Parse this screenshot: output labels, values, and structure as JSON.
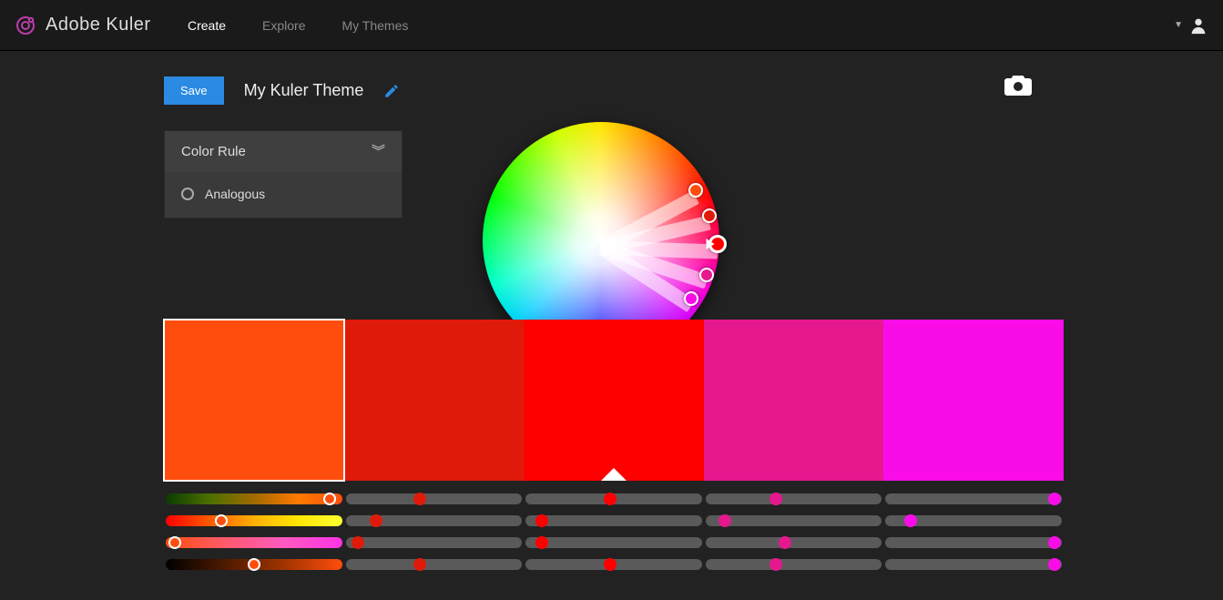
{
  "header": {
    "brand": "Adobe Kuler",
    "nav": {
      "create": "Create",
      "explore": "Explore",
      "mythemes": "My Themes"
    }
  },
  "toolbar": {
    "save_label": "Save",
    "theme_name": "My Kuler Theme"
  },
  "rule_panel": {
    "title": "Color Rule",
    "selected": "Analogous"
  },
  "colors": {
    "swatches": [
      "#FF4D0D",
      "#E01A0A",
      "#FF0000",
      "#E6188E",
      "#FA0CE8"
    ],
    "selected_index": 0,
    "base_index": 2
  },
  "wheel": {
    "handles": [
      {
        "angle": -28,
        "radius": 118,
        "color": "#FF4D0D",
        "base": false
      },
      {
        "angle": -13,
        "radius": 122,
        "color": "#E01A0A",
        "base": false
      },
      {
        "angle": 2,
        "radius": 128,
        "color": "#FF0000",
        "base": true
      },
      {
        "angle": 18,
        "radius": 122,
        "color": "#E6188E",
        "base": false
      },
      {
        "angle": 33,
        "radius": 118,
        "color": "#FA0CE8",
        "base": false
      }
    ]
  },
  "sliders": {
    "rows": [
      {
        "type": "hue-local",
        "cells": [
          {
            "gradient": "#0a3d00,#4d6f00,#a06a00,#ff7a00,#FF4D0D",
            "pos": 92,
            "thumb": "#FF4D0D",
            "selected": true
          },
          {
            "gradient": null,
            "pos": 42,
            "thumb": "#E01A0A"
          },
          {
            "gradient": null,
            "pos": 48,
            "thumb": "#FF0000"
          },
          {
            "gradient": null,
            "pos": 40,
            "thumb": "#E6188E"
          },
          {
            "gradient": null,
            "pos": 95,
            "thumb": "#FA0CE8"
          }
        ]
      },
      {
        "type": "hue-wide",
        "cells": [
          {
            "gradient": "#ff0000,#ff5a00,#ffb000,#ffe600,#ffff33",
            "pos": 32,
            "thumb": "#FF4D0D",
            "selected": true
          },
          {
            "gradient": null,
            "pos": 18,
            "thumb": "#E01A0A"
          },
          {
            "gradient": null,
            "pos": 10,
            "thumb": "#FF0000"
          },
          {
            "gradient": null,
            "pos": 12,
            "thumb": "#E6188E"
          },
          {
            "gradient": null,
            "pos": 15,
            "thumb": "#FA0CE8"
          }
        ]
      },
      {
        "type": "sat",
        "cells": [
          {
            "gradient": "#FF4D0D,#ff5a6a,#ff5abf,#ff33e6",
            "pos": 6,
            "thumb": "#FF4D0D",
            "selected": true
          },
          {
            "gradient": null,
            "pos": 8,
            "thumb": "#E01A0A"
          },
          {
            "gradient": null,
            "pos": 10,
            "thumb": "#FF0000"
          },
          {
            "gradient": null,
            "pos": 45,
            "thumb": "#E6188E"
          },
          {
            "gradient": null,
            "pos": 95,
            "thumb": "#FA0CE8"
          }
        ]
      },
      {
        "type": "bright",
        "cells": [
          {
            "gradient": "#000000,#4d1a00,#a03400,#FF4D0D",
            "pos": 50,
            "thumb": "#FF4D0D",
            "selected": true
          },
          {
            "gradient": null,
            "pos": 42,
            "thumb": "#E01A0A"
          },
          {
            "gradient": null,
            "pos": 48,
            "thumb": "#FF0000"
          },
          {
            "gradient": null,
            "pos": 40,
            "thumb": "#E6188E"
          },
          {
            "gradient": null,
            "pos": 95,
            "thumb": "#FA0CE8"
          }
        ]
      }
    ]
  }
}
